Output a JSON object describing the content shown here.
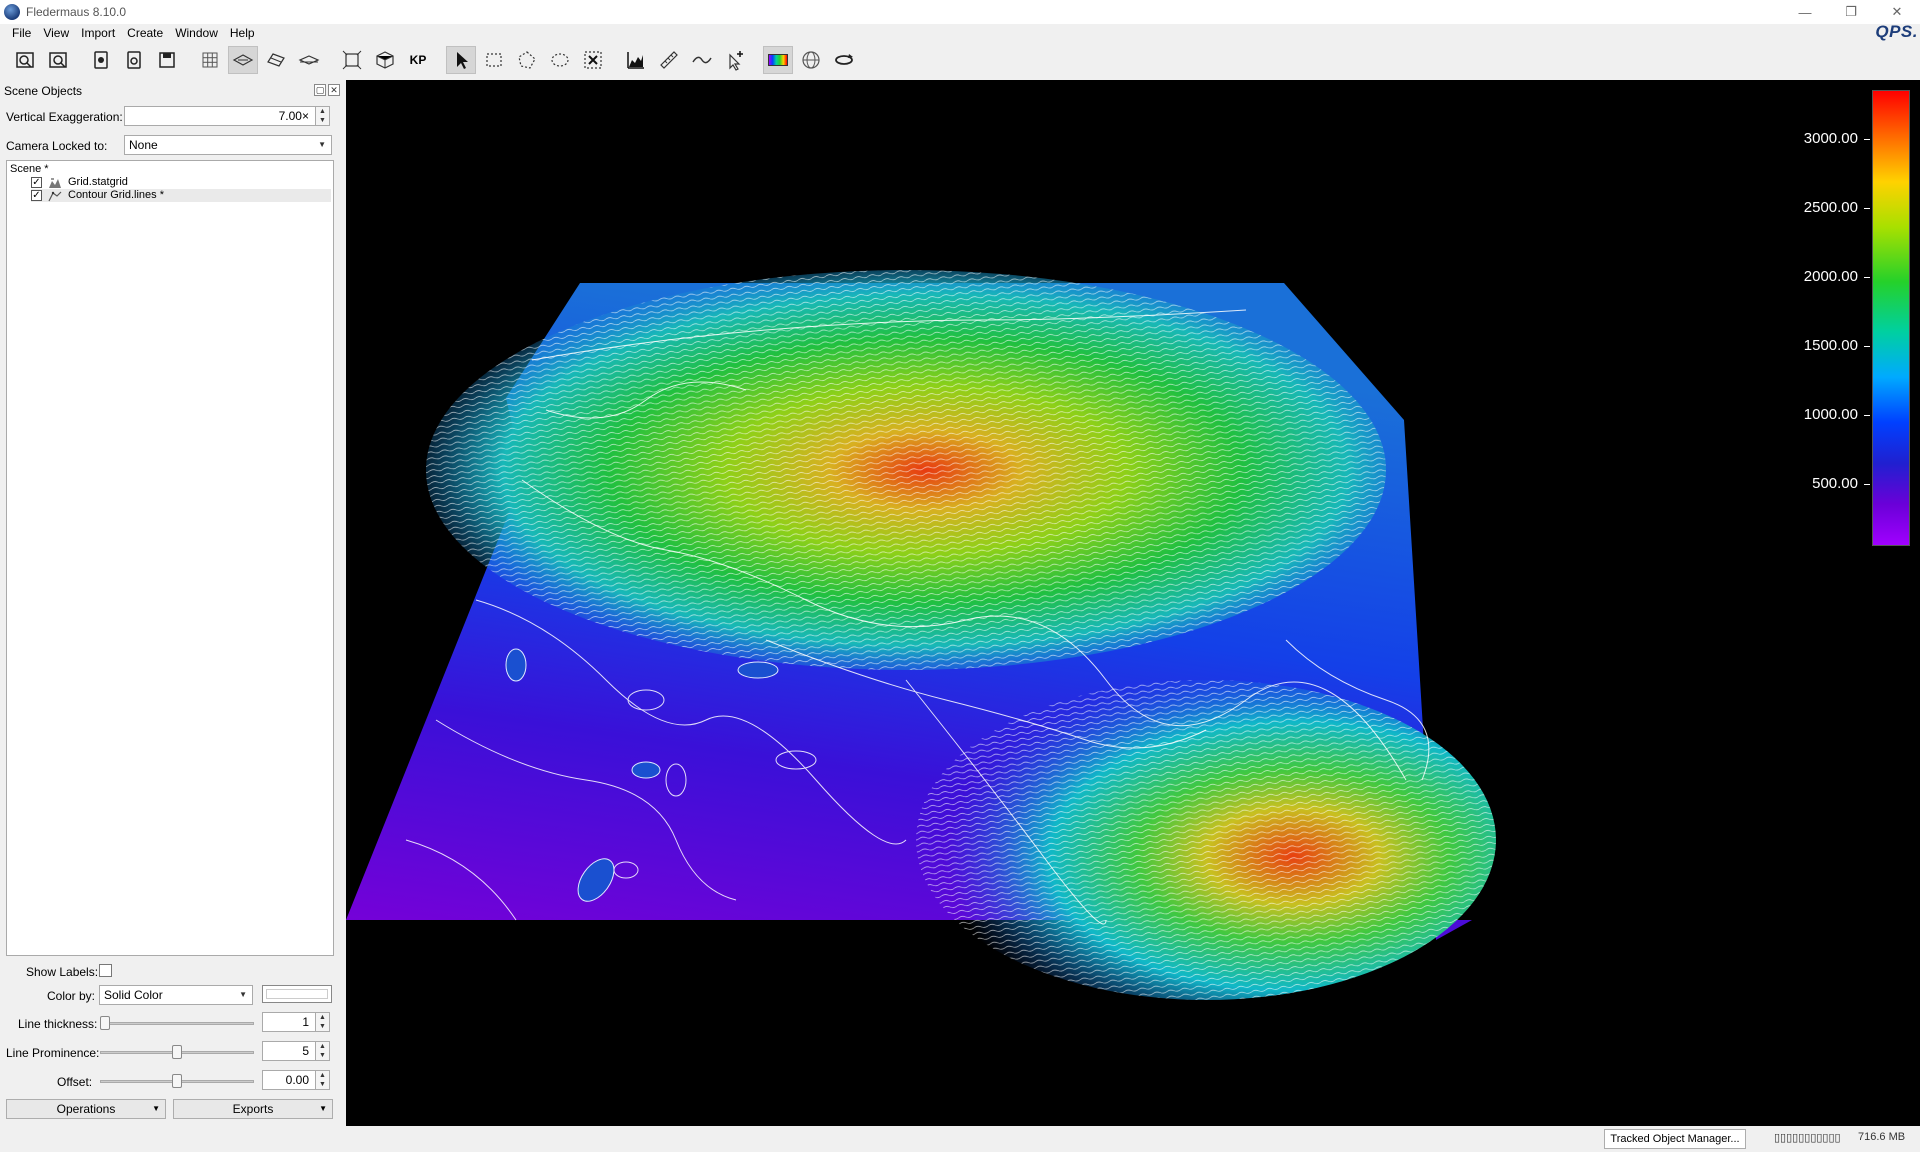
{
  "window": {
    "title": "Fledermaus 8.10.0",
    "brand": "QPS."
  },
  "menu": [
    "File",
    "View",
    "Import",
    "Create",
    "Window",
    "Help"
  ],
  "toolbar": {
    "icons": [
      "open-scene-icon",
      "open-file-icon",
      "save-icon",
      "save-as-icon",
      "export-icon",
      "grid-icon",
      "plane-view-icon",
      "tilt-view-icon",
      "side-view-icon",
      "fit-bounds-icon",
      "cube-view-icon",
      "kp-icon",
      "select-arrow-icon",
      "rect-select-icon",
      "poly-select-icon",
      "lasso-select-icon",
      "clear-selection-icon",
      "profile-chart-icon",
      "ruler-icon",
      "curve-icon",
      "add-point-icon",
      "colormap-icon",
      "globe-icon",
      "rotate-icon"
    ],
    "kp_label": "KP"
  },
  "panel": {
    "title": "Scene Objects",
    "vertical_exaggeration_label": "Vertical Exaggeration:",
    "vertical_exaggeration_value": "7.00×",
    "camera_locked_label": "Camera Locked to:",
    "camera_locked_value": "None",
    "tree": {
      "root": "Scene *",
      "items": [
        {
          "label": "Grid.statgrid",
          "checked": true,
          "icon": "grid-object-icon"
        },
        {
          "label": "Contour Grid.lines *",
          "checked": true,
          "icon": "lines-object-icon"
        }
      ]
    },
    "show_labels_label": "Show Labels:",
    "color_by_label": "Color by:",
    "color_by_value": "Solid Color",
    "line_thickness_label": "Line thickness:",
    "line_thickness_value": "1",
    "line_thickness_level": 0.0,
    "line_prominence_label": "Line Prominence:",
    "line_prominence_value": "5",
    "line_prominence_level": 0.5,
    "offset_label": "Offset:",
    "offset_value": "0.00",
    "offset_level": 0.5,
    "operations_label": "Operations",
    "exports_label": "Exports"
  },
  "colorbar": {
    "labels": [
      "3000.00",
      "2500.00",
      "2000.00",
      "1500.00",
      "1000.00",
      "500.00"
    ],
    "colors": {
      "top": "#ff0000",
      "bottom": "#a000ff"
    }
  },
  "status": {
    "tracked_button": "Tracked Object Manager...",
    "coords": "▯▯▯▯▯▯▯▯▯▯▯",
    "memory": "716.6 MB"
  }
}
